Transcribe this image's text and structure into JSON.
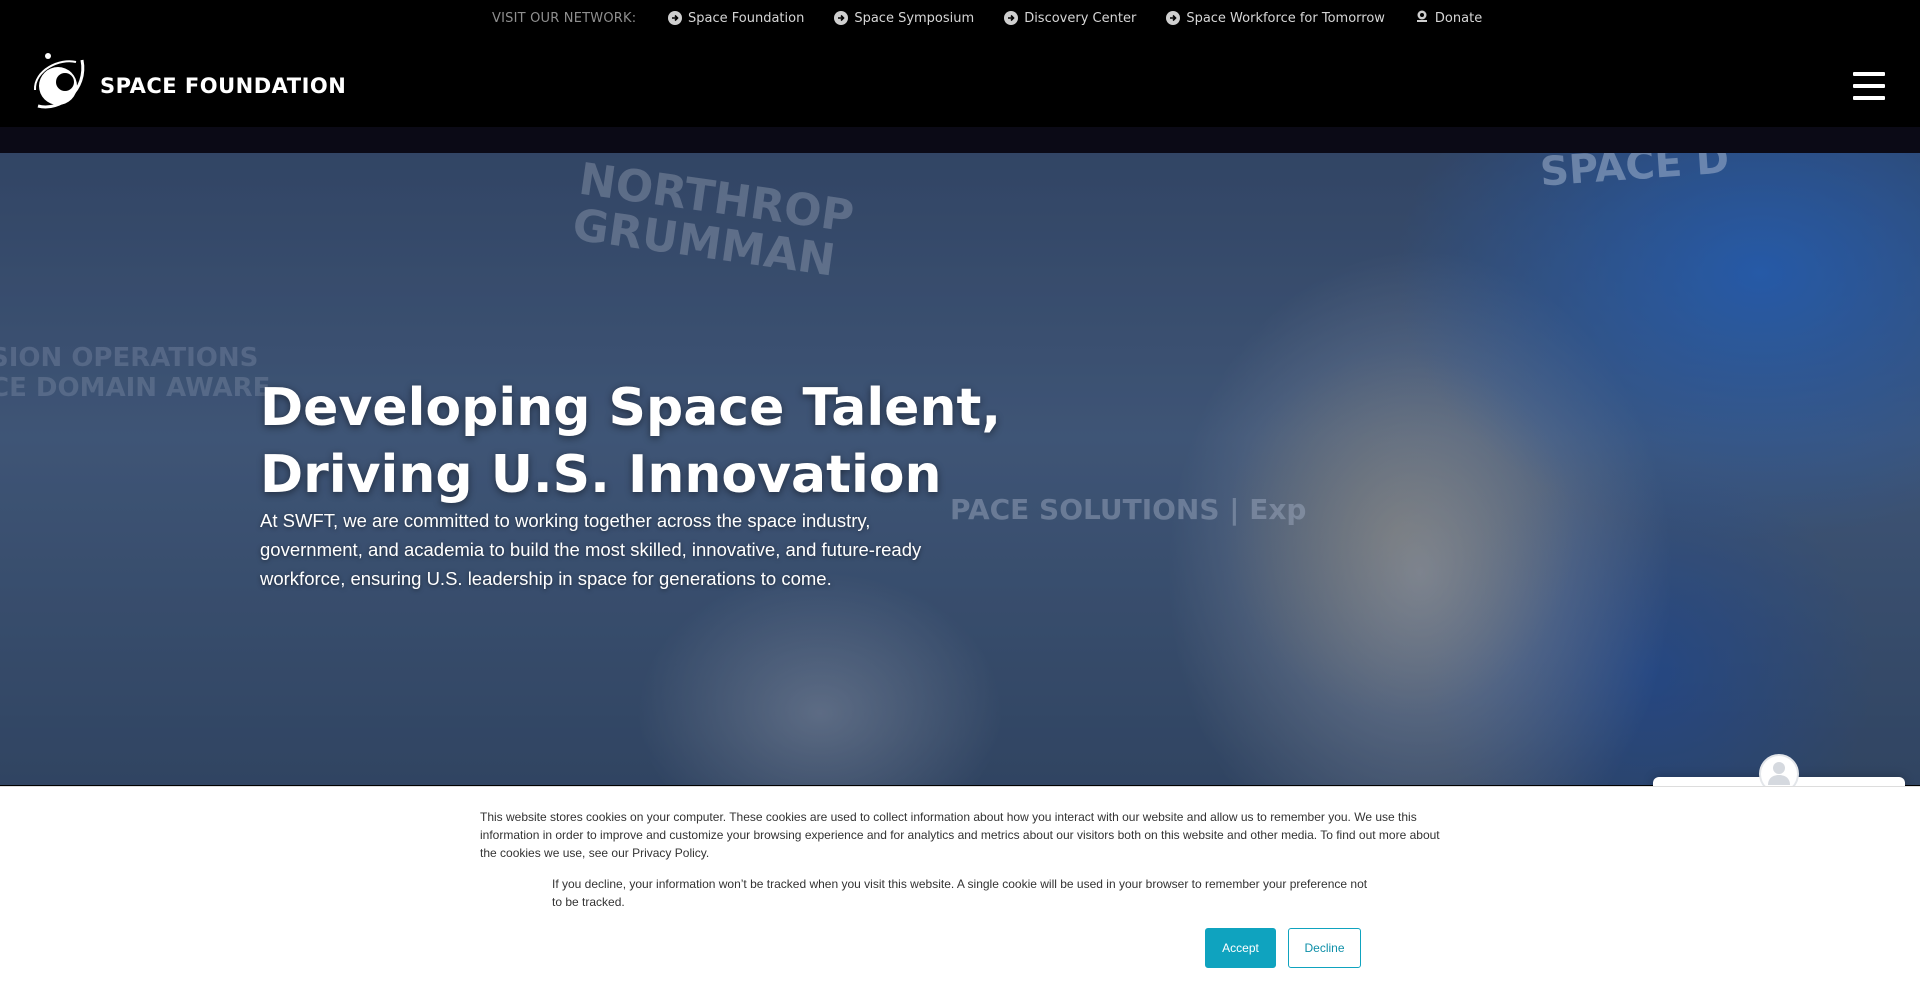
{
  "network_bar": {
    "label": "VISIT OUR NETWORK:",
    "links": [
      {
        "label": "Space Foundation",
        "icon": "arrow-circle-icon"
      },
      {
        "label": "Space Symposium",
        "icon": "arrow-circle-icon"
      },
      {
        "label": "Discovery Center",
        "icon": "arrow-circle-icon"
      },
      {
        "label": "Space Workforce for Tomorrow",
        "icon": "arrow-circle-icon"
      },
      {
        "label": "Donate",
        "icon": "donate-icon"
      }
    ]
  },
  "header": {
    "logo_text": "SPACE FOUNDATION",
    "menu_icon": "hamburger-icon"
  },
  "hero": {
    "title_line1": "Developing Space Talent,",
    "title_line2": "Driving U.S. Innovation",
    "text": "At SWFT, we are committed to working together across the space industry, government, and academia to build the most skilled, innovative, and future-ready workforce, ensuring U.S. leadership in space for generations to come.",
    "bg_signs": {
      "northrop": "NORTHROP GRUMMAN",
      "space": "SPACE D",
      "solutions": "PACE SOLUTIONS | Exp",
      "mission": "SION OPERATIONS\nCE DOMAIN AWARE"
    }
  },
  "cookie_banner": {
    "paragraph1": "This website stores cookies on your computer. These cookies are used to collect information about how you interact with our website and allow us to remember you. We use this information in order to improve and customize your browsing experience and for analytics and metrics about our visitors both on this website and other media. To find out more about the cookies we use, see our Privacy Policy.",
    "paragraph2": "If you decline, your information won’t be tracked when you visit this website. A single cookie will be used in your browser to remember your preference not to be tracked.",
    "accept_label": "Accept",
    "decline_label": "Decline"
  },
  "colors": {
    "accept_bg": "#0fa3bf",
    "header_bg": "#000000",
    "cookie_bg": "#ffffff"
  }
}
